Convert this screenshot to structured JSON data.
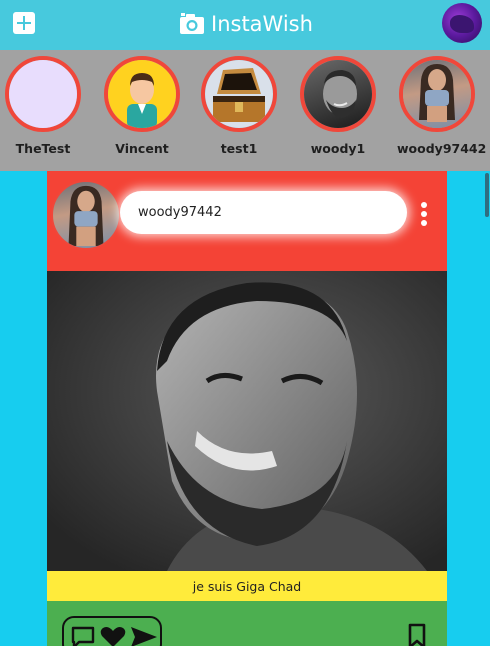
{
  "header": {
    "app_name": "InstaWish",
    "add_icon": "plus-square-icon",
    "camera_icon": "camera-icon",
    "colors": {
      "bar": "#47c9dd",
      "text": "#ffffff"
    }
  },
  "stories": [
    {
      "name": "TheTest",
      "avatar": "blank-avatar"
    },
    {
      "name": "Vincent",
      "avatar": "cartoon-person-avatar"
    },
    {
      "name": "test1",
      "avatar": "treasure-chest-avatar"
    },
    {
      "name": "woody1",
      "avatar": "bw-portrait-avatar"
    },
    {
      "name": "woody97442",
      "avatar": "photo-portrait-avatar"
    }
  ],
  "post": {
    "author": "woody97442",
    "caption": "je suis Giga Chad",
    "actions": [
      "comment-icon",
      "heart-icon",
      "share-icon",
      "bookmark-icon"
    ],
    "colors": {
      "header": "#f44336",
      "caption": "#ffeb3b",
      "actions": "#4caf50",
      "ring": "#f0473a"
    }
  },
  "page": {
    "background": "#17cdef"
  }
}
